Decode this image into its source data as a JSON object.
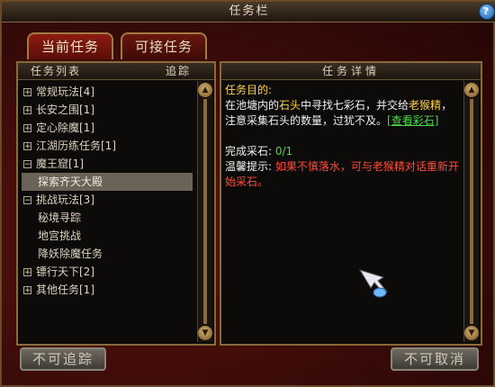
{
  "window": {
    "title": "任务栏"
  },
  "tabs": [
    {
      "label": "当前任务"
    },
    {
      "label": "可接任务"
    }
  ],
  "list_panel": {
    "header_label": "任务列表",
    "track_label": "追踪",
    "items": [
      {
        "toggle": "+",
        "label": "常规玩法[4]"
      },
      {
        "toggle": "+",
        "label": "长安之围[1]"
      },
      {
        "toggle": "+",
        "label": "定心除魔[1]"
      },
      {
        "toggle": "+",
        "label": "江湖历练任务[1]"
      },
      {
        "toggle": "−",
        "label": "魔王窟[1]"
      },
      {
        "toggle": "",
        "label": "探索齐天大殿"
      },
      {
        "toggle": "−",
        "label": "挑战玩法[3]"
      },
      {
        "toggle": "",
        "label": "秘境寻踪"
      },
      {
        "toggle": "",
        "label": "地宫挑战"
      },
      {
        "toggle": "",
        "label": "降妖除魔任务"
      },
      {
        "toggle": "+",
        "label": "镖行天下[2]"
      },
      {
        "toggle": "+",
        "label": "其他任务[1]"
      }
    ]
  },
  "detail_panel": {
    "header_label": "任务详情",
    "goal_title": "任务目的:",
    "goal_parts": [
      "在池塘内的",
      "石头",
      "中寻找七彩石，并交给",
      "老猴精",
      "，注意采集石头的数量，过犹不及。",
      "[查看彩石]"
    ],
    "progress_label": "完成采石: ",
    "progress_value": "0/1",
    "tip_label": "温馨提示: ",
    "tip_text": "如果不慎落水，可与老猴精对话重新开始采石。"
  },
  "buttons": {
    "untrack": "不可追踪",
    "cancel": "不可取消"
  },
  "colors": {
    "frame_red": "#3a0b08",
    "highlight_gold": "#ffd24a",
    "link_green": "#4ad84a",
    "warning_red": "#ff4a3a"
  }
}
